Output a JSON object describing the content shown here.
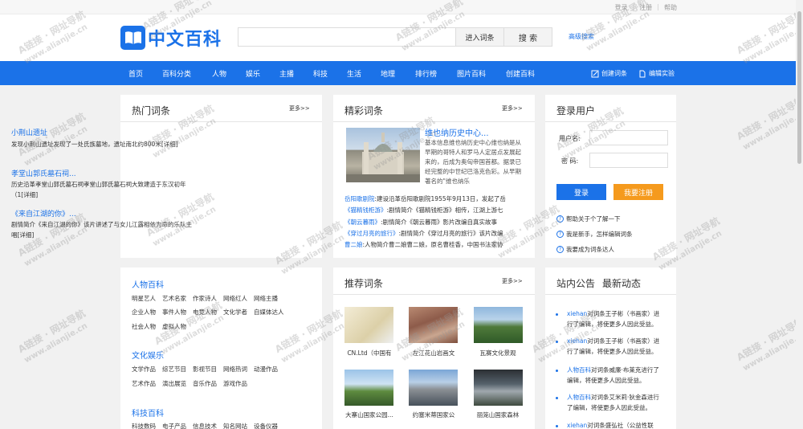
{
  "topbar": {
    "links": [
      "登录",
      "注册",
      "帮助"
    ]
  },
  "header": {
    "logo_text": "中文百科",
    "btn_enter": "进入词条",
    "btn_search": "搜 索",
    "advanced": "高级搜索",
    "search_placeholder": ""
  },
  "nav": {
    "items": [
      "首页",
      "百科分类",
      "人物",
      "娱乐",
      "主播",
      "科技",
      "生活",
      "地理",
      "排行榜",
      "图片百科",
      "创建百科"
    ],
    "create_entry": "创建词条",
    "edit_lab": "编辑实验"
  },
  "hot": {
    "title": "热门词条",
    "more": "更多>>",
    "items": [
      {
        "title": "小荆山遗址",
        "desc": "发现小荆山遗址发现了一处氏族墓地，遗址南北约800米[详细]"
      },
      {
        "title": "孝堂山郭氏墓石祠...",
        "desc": "历史沿革孝堂山郭氏墓石祠孝堂山郭氏墓石祠大致建造于东汉初年（1[详细]"
      },
      {
        "title": "《来自江湖的你》...",
        "desc": "剧情简介《来自江湖的你》该片讲述了与女儿江露相依为命的乐队主唱[详细]"
      }
    ]
  },
  "featured": {
    "title": "精彩词条",
    "more": "更多>>",
    "main_title": "维也纳历史中心...",
    "main_desc": "基本信息维也纳历史中心维也纳是从早期的哥特人和罗马人定居点发展起来的，后成为奥匈帝国首都。据录已经完整的中世纪巴洛克色彩。从早期著名的\"维也纳乐",
    "lines": [
      {
        "link": "岳阳歌剧院",
        "text": ":建设沿革岳阳歌剧院1955年9月13日，发起了岳"
      },
      {
        "link": "《猫精钱柜游》",
        "text": ":剧情简介《猫精钱柜游》相传，江湖上游七"
      },
      {
        "link": "《朝云暮雨》",
        "text": ":剧情简介《朝云暮雨》影片改编自真实故事"
      },
      {
        "link": "《穿过月亮的旅行》",
        "text": ":剧情简介《穿过月亮的旅行》该片改编"
      },
      {
        "link": "曹二娘",
        "text": ":人物简介曹二娘曹二娘，原名曹桂香，中国书法家协"
      }
    ]
  },
  "login": {
    "title": "登录用户",
    "user_label": "用户名:",
    "pass_label": "密  码:",
    "btn_login": "登录",
    "btn_register": "我要注册",
    "help": [
      "帮助关于个了解一下",
      "我是新手，怎样编辑词条",
      "我要成为词条达人"
    ]
  },
  "categories": [
    {
      "head": "人物百科",
      "rows": [
        [
          "明星艺人",
          "艺术名家",
          "作家诗人",
          "网络红人",
          "网络主播"
        ],
        [
          "企业人物",
          "事件人物",
          "电竞人物",
          "文化学者",
          "自媒体达人"
        ],
        [
          "社会人物",
          "虚拟人物"
        ]
      ]
    },
    {
      "head": "文化娱乐",
      "rows": [
        [
          "文学作品",
          "综艺节目",
          "影视节目",
          "网络热词",
          "动漫作品"
        ],
        [
          "艺术作品",
          "演出展览",
          "音乐作品",
          "游戏作品"
        ]
      ]
    },
    {
      "head": "科技百科",
      "rows": [
        [
          "科技数码",
          "电子产品",
          "信息技术",
          "知名网站",
          "设备仪器"
        ]
      ]
    }
  ],
  "recommend": {
    "title": "推荐词条",
    "more": "更多>>",
    "items": [
      "CN.Ltd（中国有",
      "左江花山岩画文",
      "瓦赛文化景观",
      "大寨山国家公园...",
      "约塞米蒂国家公",
      "丽笼山国家森林"
    ]
  },
  "news": {
    "tab_notice": "站内公告",
    "tab_latest": "最新动态",
    "items": [
      {
        "link": "xiehan",
        "text": "对词条王子彬（书画家）进行了编辑，将使更多人因此受益。"
      },
      {
        "link": "xiehan",
        "text": "对词条王子彬（书画家）进行了编辑，将使更多人因此受益。"
      },
      {
        "link": "人物百科",
        "text": "对词条威廉·布莱克进行了编辑，将使更多人因此受益。"
      },
      {
        "link": "人物百科",
        "text": "对词条艾米莉·狄金森进行了编辑，将使更多人因此受益。"
      },
      {
        "link": "xiehan",
        "text": "对词条盛弘社（公益性联"
      }
    ]
  },
  "watermark": {
    "brand": "A链接 · 网址导航",
    "url": "www.alianjie.cn"
  },
  "colors": {
    "accent": "#1b72e8",
    "register": "#f59a1d"
  }
}
